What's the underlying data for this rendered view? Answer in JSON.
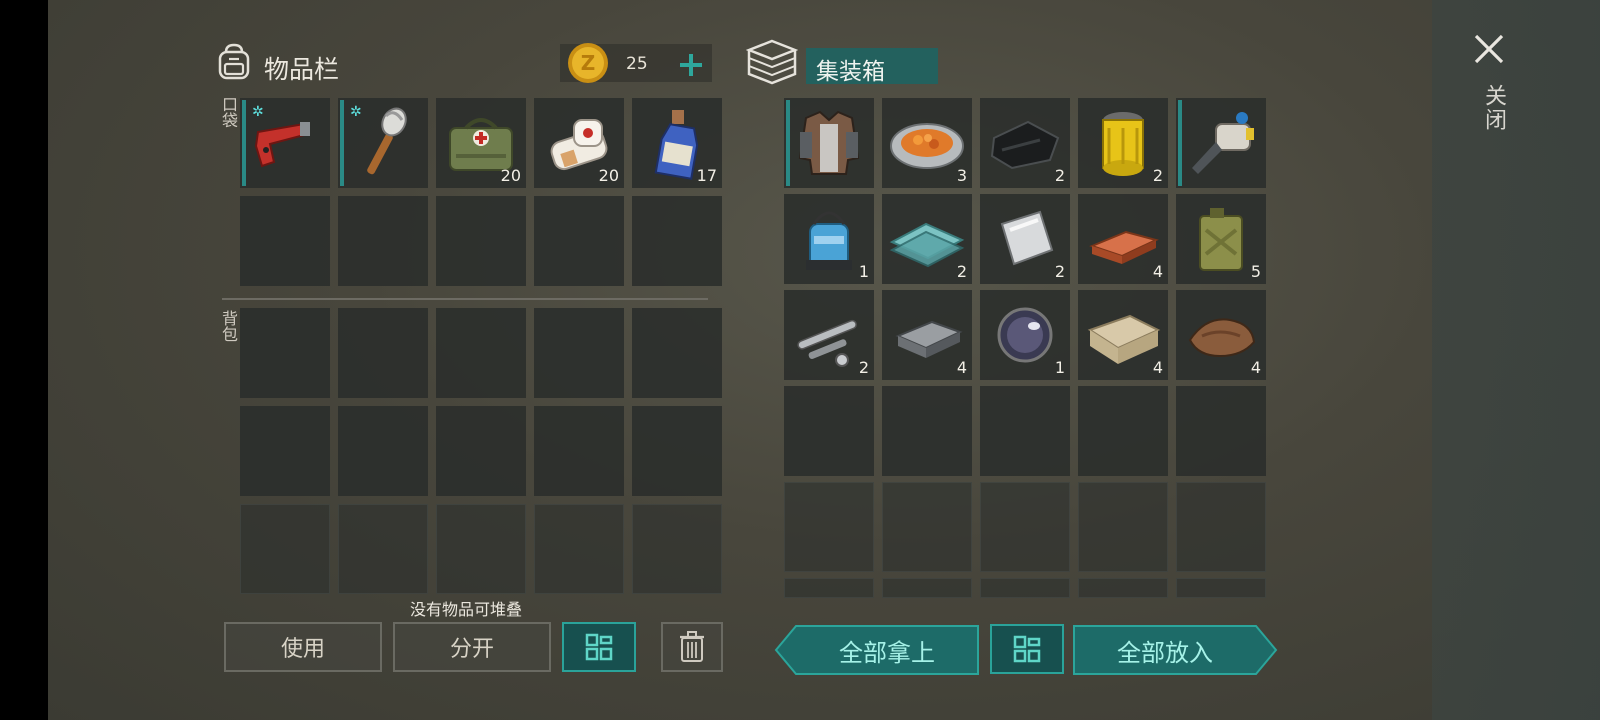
{
  "inventory": {
    "title": "物品栏",
    "coins": "25",
    "pocket_label": "口袋",
    "backpack_label": "背包",
    "pocket_items": [
      {
        "name": "flare-gun",
        "qty": ""
      },
      {
        "name": "torch",
        "qty": ""
      },
      {
        "name": "medical-bag",
        "qty": "20"
      },
      {
        "name": "bandage",
        "qty": "20"
      },
      {
        "name": "bottle",
        "qty": "17"
      }
    ]
  },
  "container": {
    "title": "集装箱",
    "items": [
      {
        "name": "leather-jacket",
        "qty": ""
      },
      {
        "name": "food-plate",
        "qty": "3"
      },
      {
        "name": "black-cloth",
        "qty": "2"
      },
      {
        "name": "oil-filter",
        "qty": "2"
      },
      {
        "name": "drill",
        "qty": ""
      },
      {
        "name": "water-pump",
        "qty": "1"
      },
      {
        "name": "glass-sheets",
        "qty": "2"
      },
      {
        "name": "metal-sheet",
        "qty": "2"
      },
      {
        "name": "copper-ingot",
        "qty": "4"
      },
      {
        "name": "jerry-can",
        "qty": "5"
      },
      {
        "name": "pipe-parts",
        "qty": "2"
      },
      {
        "name": "iron-ingot",
        "qty": "4"
      },
      {
        "name": "lens",
        "qty": "1"
      },
      {
        "name": "fabric-roll",
        "qty": "4"
      },
      {
        "name": "fur-pelt",
        "qty": "4"
      }
    ]
  },
  "status_text": "没有物品可堆叠",
  "buttons": {
    "use": "使用",
    "split": "分开",
    "take_all": "全部拿上",
    "put_all": "全部放入"
  },
  "close_label": "关闭",
  "colors": {
    "accent": "#2a8a86",
    "teal_button": "#1d6b68",
    "coin": "#d9a521"
  }
}
